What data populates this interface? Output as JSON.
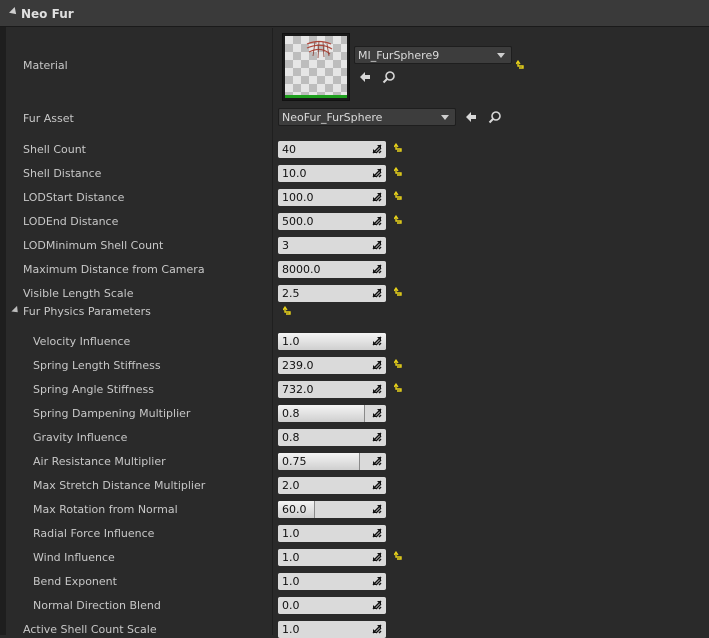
{
  "section": {
    "title": "Neo Fur"
  },
  "material": {
    "label": "Material",
    "value": "MI_FurSphere9"
  },
  "fur_asset": {
    "label": "Fur Asset",
    "value": "NeoFur_FurSphere"
  },
  "properties": [
    {
      "label": "Shell Count",
      "value": "40",
      "reset": true
    },
    {
      "label": "Shell Distance",
      "value": "10.0",
      "reset": true
    },
    {
      "label": "LODStart Distance",
      "value": "100.0",
      "reset": true
    },
    {
      "label": "LODEnd Distance",
      "value": "500.0",
      "reset": true
    },
    {
      "label": "LODMinimum Shell Count",
      "value": "3",
      "reset": false
    },
    {
      "label": "Maximum Distance from Camera",
      "value": "8000.0",
      "reset": false
    },
    {
      "label": "Visible Length Scale",
      "value": "2.5",
      "reset": true
    }
  ],
  "physics": {
    "label": "Fur Physics Parameters",
    "items": [
      {
        "label": "Velocity Influence",
        "value": "1.0",
        "fill": 1.0,
        "reset": false
      },
      {
        "label": "Spring Length Stiffness",
        "value": "239.0",
        "fill": 0,
        "reset": true
      },
      {
        "label": "Spring Angle Stiffness",
        "value": "732.0",
        "fill": 0,
        "reset": true
      },
      {
        "label": "Spring Dampening Multiplier",
        "value": "0.8",
        "fill": 0.8,
        "reset": false
      },
      {
        "label": "Gravity Influence",
        "value": "0.8",
        "fill": 0,
        "reset": false
      },
      {
        "label": "Air Resistance Multiplier",
        "value": "0.75",
        "fill": 0.75,
        "reset": false
      },
      {
        "label": "Max Stretch Distance Multiplier",
        "value": "2.0",
        "fill": 0,
        "reset": false
      },
      {
        "label": "Max Rotation from Normal",
        "value": "60.0",
        "fill": 0.33,
        "reset": false
      },
      {
        "label": "Radial Force Influence",
        "value": "1.0",
        "fill": 0,
        "reset": false
      },
      {
        "label": "Wind Influence",
        "value": "1.0",
        "fill": 0,
        "reset": true
      },
      {
        "label": "Bend Exponent",
        "value": "1.0",
        "fill": 0,
        "reset": false
      },
      {
        "label": "Normal Direction Blend",
        "value": "0.0",
        "fill": 0,
        "reset": false
      }
    ]
  },
  "footer_property": {
    "label": "Active Shell Count Scale",
    "value": "1.0"
  },
  "colors": {
    "reset_arrow": "#e8d21a",
    "panel": "#2a2a2a",
    "spin_bg": "#dadada"
  }
}
